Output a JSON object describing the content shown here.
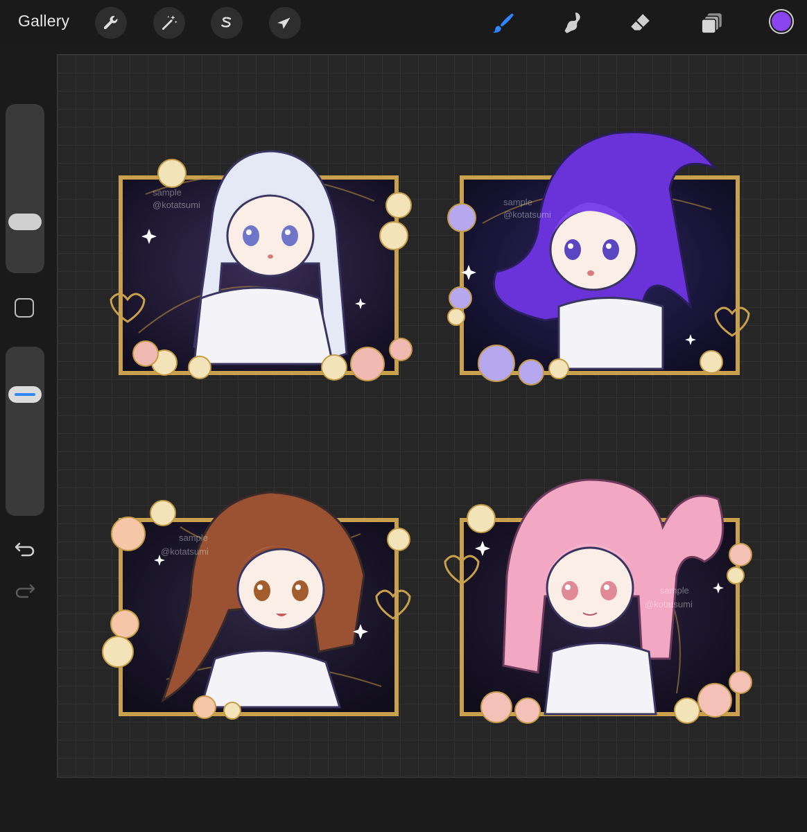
{
  "toolbar": {
    "gallery_label": "Gallery",
    "left_tools": [
      "wrench-icon",
      "magic-wand-icon",
      "selection-icon",
      "transform-arrow-icon"
    ],
    "right_tools": [
      "brush-icon",
      "smudge-icon",
      "eraser-icon",
      "layers-icon"
    ],
    "active_tool": "brush-icon",
    "active_color": "#8b45f0",
    "accent": "#2f86ff"
  },
  "sidebar": {
    "controls": [
      "brush-size-slider",
      "modify-button",
      "opacity-slider",
      "undo-icon",
      "redo-icon"
    ]
  },
  "canvas": {
    "panels": [
      {
        "id": "silver",
        "watermark": [
          "sample",
          "@kotatsumi"
        ],
        "hair_color": "#e3e8f4"
      },
      {
        "id": "purple",
        "watermark": [
          "sample",
          "@kotatsumi"
        ],
        "hair_color": "#6a33d9"
      },
      {
        "id": "brown",
        "watermark": [
          "sample",
          "@kotatsumi"
        ],
        "hair_color": "#9a5232"
      },
      {
        "id": "pink",
        "watermark": [
          "sample",
          "@kotatsumi"
        ],
        "hair_color": "#f2a7c3"
      }
    ]
  }
}
